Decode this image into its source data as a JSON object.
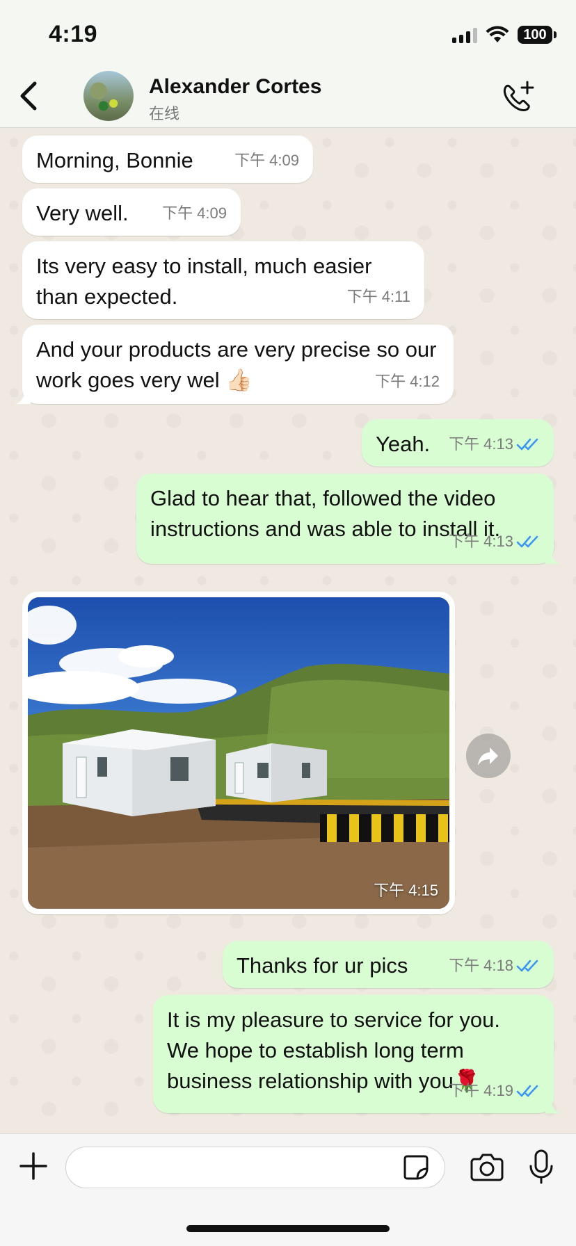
{
  "status_bar": {
    "time": "4:19",
    "battery": "100"
  },
  "header": {
    "contact_name": "Alexander Cortes",
    "contact_status": "在线"
  },
  "messages": [
    {
      "text": "Morning, Bonnie",
      "time": "下午 4:09",
      "direction": "incoming"
    },
    {
      "text": "Very well.",
      "time": "下午 4:09",
      "direction": "incoming"
    },
    {
      "text": "Its very easy to install, much easier than expected.",
      "time": "下午 4:11",
      "direction": "incoming"
    },
    {
      "text": "And your products are very precise so our work goes very wel 👍🏻",
      "time": "下午 4:12",
      "direction": "incoming"
    },
    {
      "text": "Yeah.",
      "time": "下午 4:13",
      "direction": "outgoing",
      "read": true
    },
    {
      "text": "Glad to hear that, followed the video instructions and was able to install it.",
      "time": "下午 4:13",
      "direction": "outgoing",
      "read": true
    },
    {
      "type": "image",
      "time": "下午 4:15",
      "direction": "incoming"
    },
    {
      "text": "Thanks for ur pics",
      "time": "下午 4:18",
      "direction": "outgoing",
      "read": true
    },
    {
      "text": "It is my pleasure to service for you. We hope to establish long term business relationship with you🌹",
      "time": "下午 4:19",
      "direction": "outgoing",
      "read": true
    }
  ],
  "composer": {
    "placeholder": ""
  },
  "colors": {
    "incoming_bubble": "#ffffff",
    "outgoing_bubble": "#d9fdd3",
    "read_ticks": "#3b96f3",
    "timestamp": "#7a7a7a"
  },
  "icons": [
    "back-chevron-icon",
    "call-add-icon",
    "plus-icon",
    "sticker-icon",
    "camera-icon",
    "mic-icon",
    "forward-icon",
    "double-check-icon"
  ]
}
